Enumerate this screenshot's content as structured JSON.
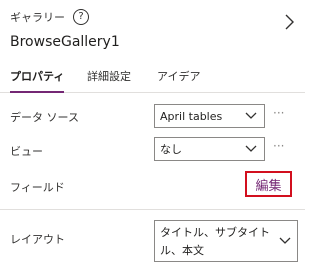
{
  "header": {
    "gallery_type": "ギャラリー",
    "help_icon": "question-circle-icon",
    "control_name": "BrowseGallery1",
    "expand_icon": "chevron-right-icon"
  },
  "tabs": [
    {
      "label": "プロパティ",
      "active": true
    },
    {
      "label": "詳細設定",
      "active": false
    },
    {
      "label": "アイデア",
      "active": false
    }
  ],
  "properties": {
    "data_source": {
      "label": "データ ソース",
      "value": "April tables",
      "more": "···"
    },
    "view": {
      "label": "ビュー",
      "value": "なし",
      "more": "···"
    },
    "fields": {
      "label": "フィールド",
      "edit_label": "編集"
    },
    "layout": {
      "label": "レイアウト",
      "value": "タイトル、サブタイトル、本文"
    }
  },
  "colors": {
    "accent": "#742774",
    "highlight_border": "#d20f1e"
  }
}
